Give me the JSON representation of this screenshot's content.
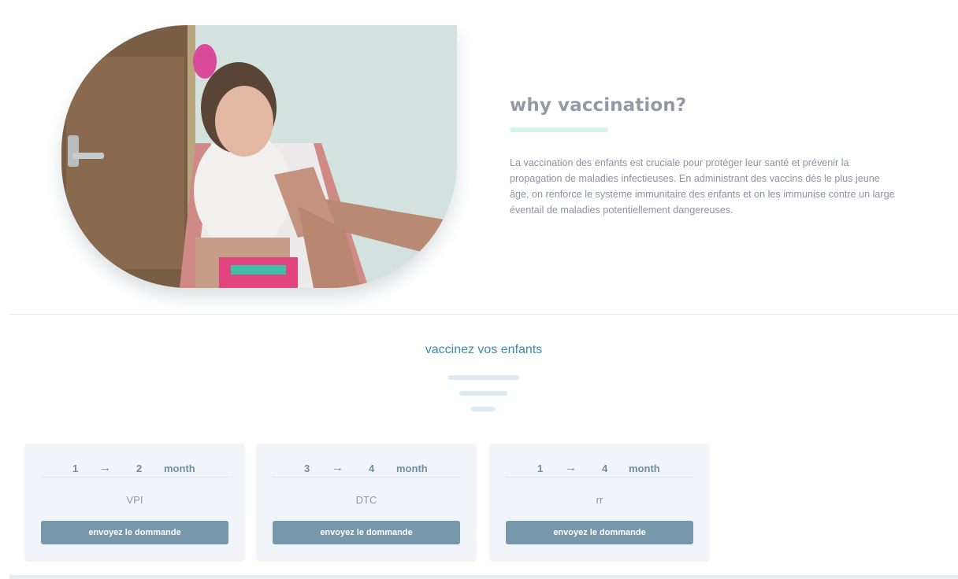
{
  "hero": {
    "title": "why vaccination?",
    "paragraph": "La vaccination des enfants est cruciale pour protéger leur santé et prévenir la propagation de maladies infectieuses. En administrant des vaccins dès le plus jeune âge, on renforce le système immunitaire des enfants et on les immunise contre un large éventail de maladies potentiellement dangereuses."
  },
  "section": {
    "title": "vaccinez vos enfants"
  },
  "cards": [
    {
      "from": "1",
      "arrow": "→",
      "to": "2",
      "unit": "month",
      "name": "VPI",
      "button": "envoyez le dommande"
    },
    {
      "from": "3",
      "arrow": "→",
      "to": "4",
      "unit": "month",
      "name": "DTC",
      "button": "envoyez le dommande"
    },
    {
      "from": "1",
      "arrow": "→",
      "to": "4",
      "unit": "month",
      "name": "rr",
      "button": "envoyez le dommande"
    }
  ],
  "colors": {
    "accent": "#3e8ba6",
    "button": "#7797aa",
    "card_bg": "#f1f4f8"
  }
}
